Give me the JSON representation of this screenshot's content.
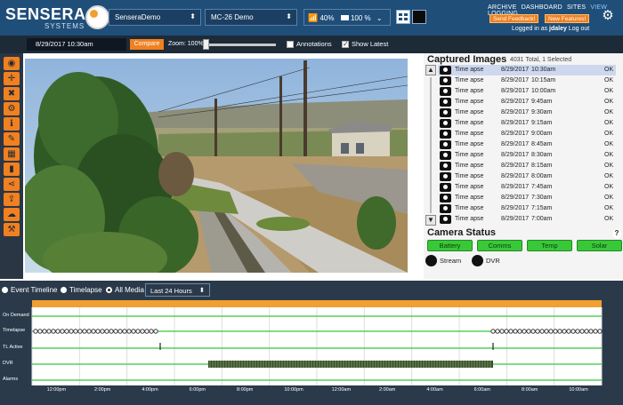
{
  "header": {
    "logo_text": "SENSERA",
    "logo_sub": "SYSTEMS",
    "site_select": "SenseraDemo",
    "camera_select": "MC-26 Demo",
    "signal_value": "40%",
    "battery_value": "100 %",
    "nav_links": [
      "ARCHIVE",
      "DASHBOARD",
      "SITES",
      "VIEW",
      "LOGGING"
    ],
    "active_nav": "VIEW",
    "feedback_button": "Send Feedback!",
    "features_button": "New Features!",
    "logged_in_prefix": "Logged in as",
    "username": "jdaley",
    "logout_link": "Log out"
  },
  "subbar": {
    "date_value": "8/29/2017   10:30am",
    "compare_button": "Compare",
    "zoom_label": "Zoom: 100%",
    "zoom_level": 0.0,
    "annotations_label": "Annotations",
    "annotations_checked": false,
    "show_latest_label": "Show Latest",
    "show_latest_checked": true
  },
  "toolbar": {
    "icons": [
      "camera-icon",
      "target-icon",
      "tools-icon",
      "settings-icon",
      "info-icon",
      "pencil-icon",
      "calendar-icon",
      "trash-icon",
      "share-icon",
      "upload-icon",
      "cloud-icon",
      "wrench-icon"
    ]
  },
  "captured": {
    "title": "Captured Images",
    "summary": "4031 Total, 1 Selected",
    "rows": [
      {
        "type": "Time apse",
        "date": "8/29/2017",
        "time": "10:30am",
        "status": "OK",
        "selected": true
      },
      {
        "type": "Time apse",
        "date": "8/29/2017",
        "time": "10:15am",
        "status": "OK",
        "selected": false
      },
      {
        "type": "Time apse",
        "date": "8/29/2017",
        "time": "10:00am",
        "status": "OK",
        "selected": false
      },
      {
        "type": "Time apse",
        "date": "8/29/2017",
        "time": "9:45am",
        "status": "OK",
        "selected": false
      },
      {
        "type": "Time apse",
        "date": "8/29/2017",
        "time": "9:30am",
        "status": "OK",
        "selected": false
      },
      {
        "type": "Time apse",
        "date": "8/29/2017",
        "time": "9:15am",
        "status": "OK",
        "selected": false
      },
      {
        "type": "Time apse",
        "date": "8/29/2017",
        "time": "9:00am",
        "status": "OK",
        "selected": false
      },
      {
        "type": "Time apse",
        "date": "8/29/2017",
        "time": "8:45am",
        "status": "OK",
        "selected": false
      },
      {
        "type": "Time apse",
        "date": "8/29/2017",
        "time": "8:30am",
        "status": "OK",
        "selected": false
      },
      {
        "type": "Time apse",
        "date": "8/29/2017",
        "time": "8:15am",
        "status": "OK",
        "selected": false
      },
      {
        "type": "Time apse",
        "date": "8/29/2017",
        "time": "8:00am",
        "status": "OK",
        "selected": false
      },
      {
        "type": "Time apse",
        "date": "8/29/2017",
        "time": "7:45am",
        "status": "OK",
        "selected": false
      },
      {
        "type": "Time apse",
        "date": "8/29/2017",
        "time": "7:30am",
        "status": "OK",
        "selected": false
      },
      {
        "type": "Time apse",
        "date": "8/29/2017",
        "time": "7:15am",
        "status": "OK",
        "selected": false
      },
      {
        "type": "Time apse",
        "date": "8/29/2017",
        "time": "7:00am",
        "status": "OK",
        "selected": false
      }
    ]
  },
  "camera_status": {
    "title": "Camera Status",
    "buttons": [
      "Battery",
      "Comms",
      "Temp",
      "Solar"
    ],
    "indicators": [
      "Stream",
      "DVR"
    ]
  },
  "timeline": {
    "filters": [
      {
        "label": "Event Timeline",
        "selected": false
      },
      {
        "label": "Timelapse",
        "selected": false
      },
      {
        "label": "All Media",
        "selected": true
      }
    ],
    "range_select": "Last 24 Hours",
    "rows": [
      "On Demand",
      "Timelapse",
      "TL Active",
      "DVR",
      "Alarms"
    ],
    "x_labels": [
      "12:00pm",
      "2:00pm",
      "4:00pm",
      "6:00pm",
      "8:00pm",
      "10:00pm",
      "12:00am",
      "2:00am",
      "4:00am",
      "6:00am",
      "8:00am",
      "10:00am"
    ]
  },
  "colors": {
    "header_bg": "#1f4e79",
    "accent": "#f08020",
    "status_green": "#39c839",
    "timeline_bg": "#2b3a4a",
    "timeline_line": "#35c83a"
  }
}
